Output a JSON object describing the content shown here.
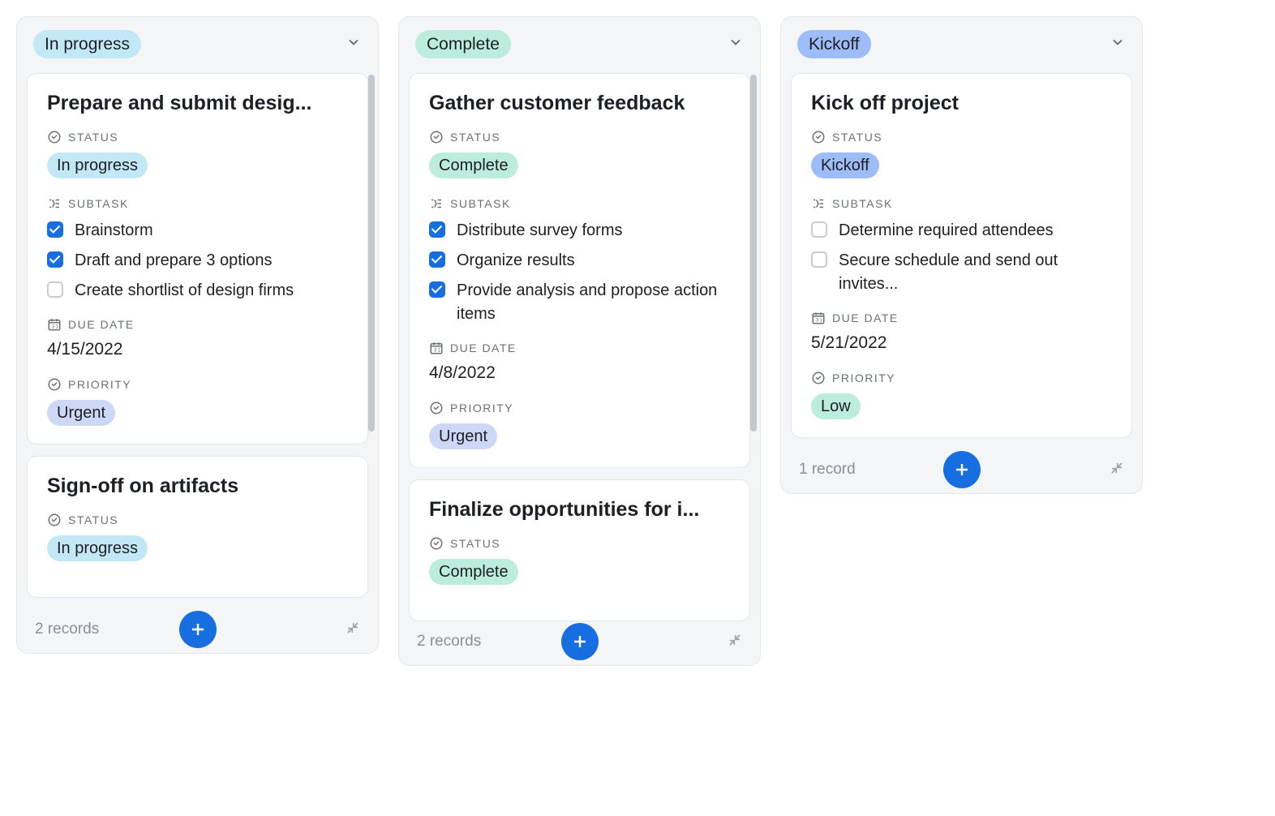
{
  "labels": {
    "status": "STATUS",
    "subtask": "SUBTASK",
    "due_date": "DUE DATE",
    "priority": "PRIORITY"
  },
  "columns": [
    {
      "id": "in-progress",
      "name": "In progress",
      "tag_class": "tag-blue",
      "record_count": "2 records",
      "scrollable": true,
      "cards": [
        {
          "title": "Prepare and submit desig...",
          "status": {
            "text": "In progress",
            "class": "tag-blue"
          },
          "subtasks": [
            {
              "text": "Brainstorm",
              "checked": true
            },
            {
              "text": "Draft and prepare 3 options",
              "checked": true
            },
            {
              "text": "Create shortlist of design firms",
              "checked": false
            }
          ],
          "due_date": "4/15/2022",
          "priority": {
            "text": "Urgent",
            "class": "tag-urgent"
          }
        },
        {
          "title": "Sign-off on artifacts",
          "status": {
            "text": "In progress",
            "class": "tag-blue"
          },
          "partial": true
        }
      ]
    },
    {
      "id": "complete",
      "name": "Complete",
      "tag_class": "tag-green",
      "record_count": "2 records",
      "scrollable": true,
      "cards": [
        {
          "title": "Gather customer feedback",
          "status": {
            "text": "Complete",
            "class": "tag-green"
          },
          "subtasks": [
            {
              "text": "Distribute survey forms",
              "checked": true
            },
            {
              "text": "Organize results",
              "checked": true
            },
            {
              "text": "Provide analysis and propose action items",
              "checked": true
            }
          ],
          "due_date": "4/8/2022",
          "priority": {
            "text": "Urgent",
            "class": "tag-urgent"
          }
        },
        {
          "title": "Finalize opportunities for i...",
          "status": {
            "text": "Complete",
            "class": "tag-green"
          },
          "partial": true
        }
      ]
    },
    {
      "id": "kickoff",
      "name": "Kickoff",
      "tag_class": "tag-periwinkle",
      "record_count": "1 record",
      "scrollable": false,
      "cards": [
        {
          "title": "Kick off project",
          "status": {
            "text": "Kickoff",
            "class": "tag-periwinkle"
          },
          "subtasks": [
            {
              "text": "Determine required attendees",
              "checked": false
            },
            {
              "text": "Secure schedule and send out invites...",
              "checked": false
            }
          ],
          "due_date": "5/21/2022",
          "priority": {
            "text": "Low",
            "class": "tag-low"
          }
        }
      ]
    }
  ]
}
